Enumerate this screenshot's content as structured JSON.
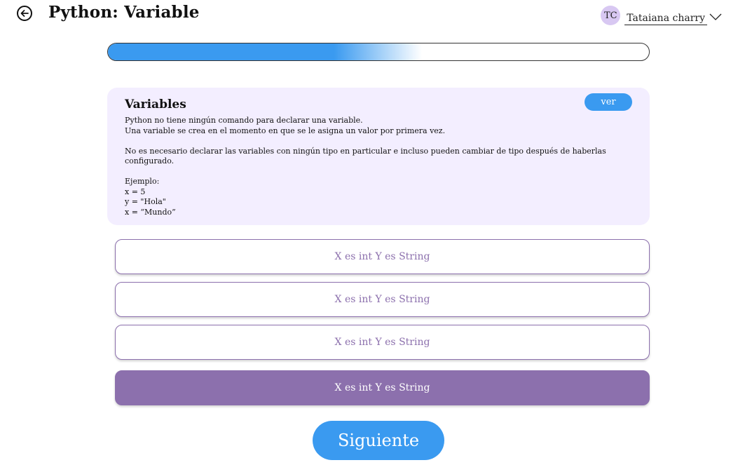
{
  "header": {
    "title": "Python: Variable",
    "user": {
      "initials": "TC",
      "name": "Tataiana charry"
    }
  },
  "progress": {
    "value_percent": 58
  },
  "lesson": {
    "heading": "Variables",
    "view_button": "ver",
    "lines": [
      "Python no tiene ningún comando para declarar una variable.",
      "Una variable se crea en el momento en que se le asigna un valor por primera vez.",
      "",
      "No es necesario declarar las variables con ningún tipo en particular e incluso pueden cambiar de tipo después de haberlas configurado.",
      "",
      "Ejemplo:",
      "x = 5",
      "y = \"Hola\"",
      "x = “Mundo”"
    ]
  },
  "options": [
    {
      "label": "X es int Y es String",
      "selected": false
    },
    {
      "label": "X es int Y es String",
      "selected": false
    },
    {
      "label": "X es int Y es String",
      "selected": false
    },
    {
      "label": "X es int Y es String",
      "selected": true
    }
  ],
  "next_button": "Siguiente",
  "colors": {
    "accent_blue": "#3a9af0",
    "accent_purple": "#8c70ad",
    "card_bg": "#f3eeff",
    "avatar_bg": "#d8c8f2"
  },
  "icons": {
    "back": "arrow-left-circle-icon",
    "dropdown": "chevron-down-icon"
  }
}
